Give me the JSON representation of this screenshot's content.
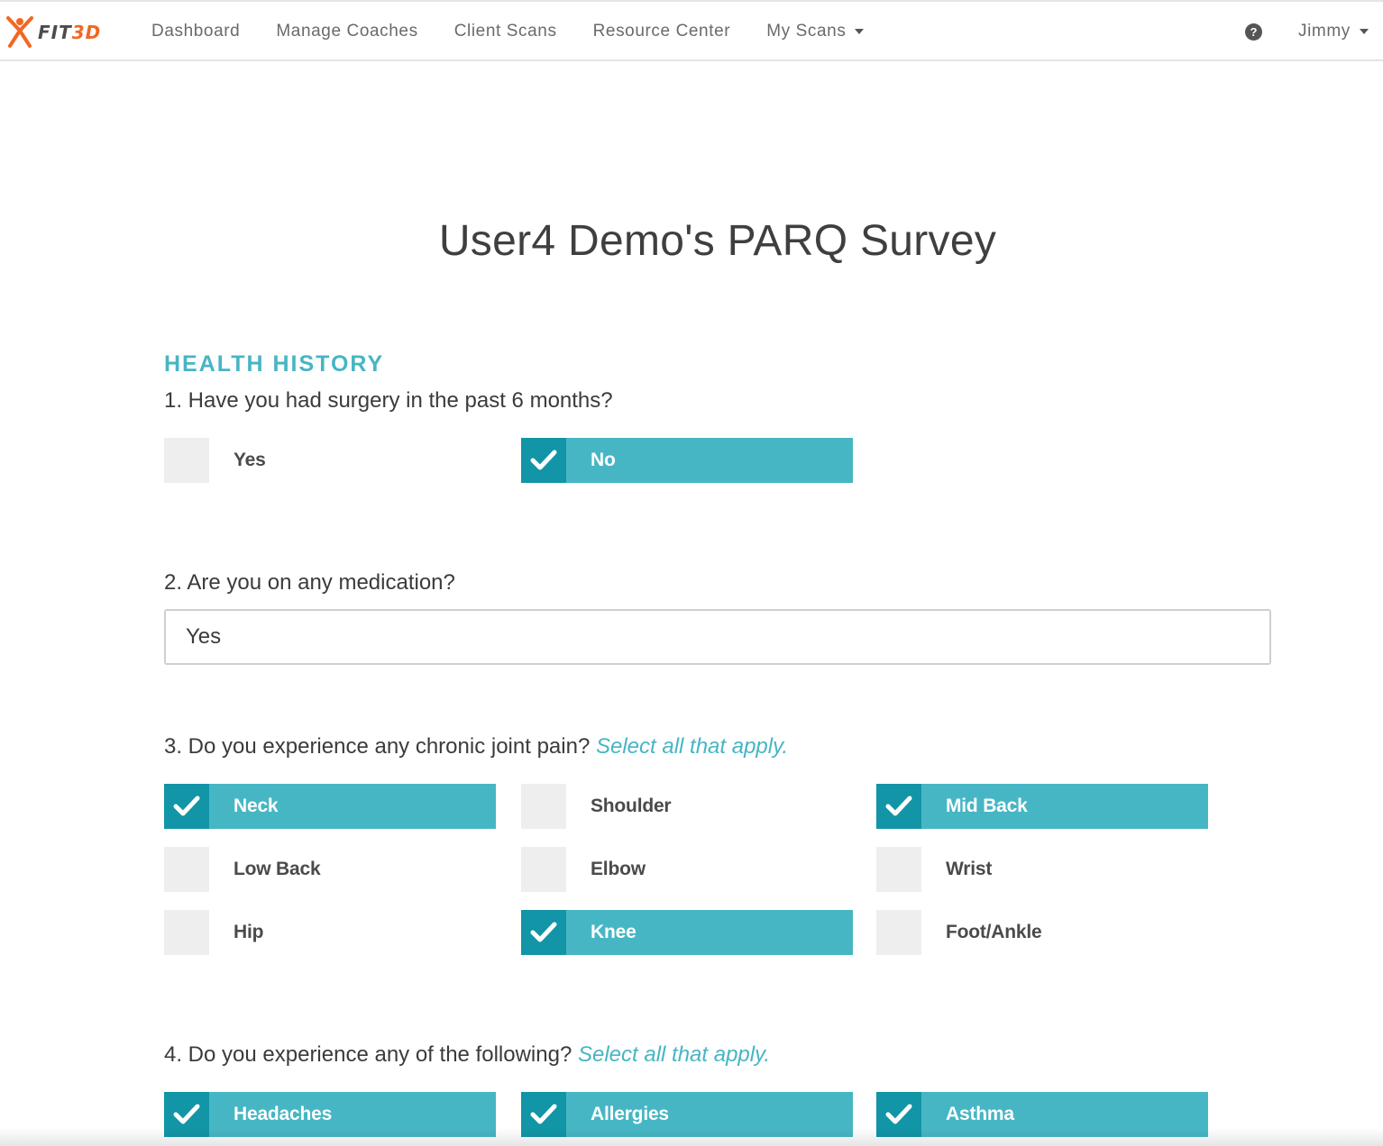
{
  "nav": {
    "logo": {
      "text_fit": "FIT",
      "text_3d": "3D"
    },
    "links": [
      "Dashboard",
      "Manage Coaches",
      "Client Scans",
      "Resource Center",
      "My Scans"
    ],
    "help_icon": "question-circle-icon",
    "user_label": "Jimmy"
  },
  "page": {
    "title": "User4 Demo's PARQ Survey",
    "section": "HEALTH HISTORY"
  },
  "questions": {
    "q1": {
      "text": "1. Have you had surgery in the past 6 months?",
      "options": [
        {
          "label": "Yes",
          "checked": false
        },
        {
          "label": "No",
          "checked": true
        }
      ]
    },
    "q2": {
      "text": "2. Are you on any medication?",
      "value": "Yes"
    },
    "q3": {
      "text": "3. Do you experience any chronic joint pain?",
      "hint": "Select all that apply.",
      "options": [
        {
          "label": "Neck",
          "checked": true
        },
        {
          "label": "Shoulder",
          "checked": false
        },
        {
          "label": "Mid Back",
          "checked": true
        },
        {
          "label": "Low Back",
          "checked": false
        },
        {
          "label": "Elbow",
          "checked": false
        },
        {
          "label": "Wrist",
          "checked": false
        },
        {
          "label": "Hip",
          "checked": false
        },
        {
          "label": "Knee",
          "checked": true
        },
        {
          "label": "Foot/Ankle",
          "checked": false
        }
      ]
    },
    "q4": {
      "text": "4. Do you experience any of the following?",
      "hint": "Select all that apply.",
      "options": [
        {
          "label": "Headaches",
          "checked": true
        },
        {
          "label": "Allergies",
          "checked": true
        },
        {
          "label": "Asthma",
          "checked": true
        }
      ]
    }
  },
  "colors": {
    "accent": "#47b6c4",
    "accent_dark": "#1295a6",
    "unchecked_box": "#eeeeee",
    "logo_orange": "#f26722"
  }
}
